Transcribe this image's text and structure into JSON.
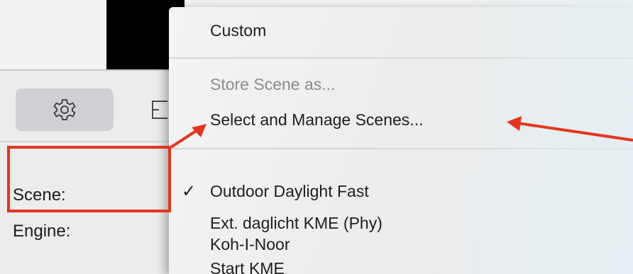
{
  "panel": {
    "scene_label": "Scene:",
    "engine_label": "Engine:"
  },
  "icons": {
    "settings": "gear-icon",
    "partial": "panel-icon"
  },
  "menu": {
    "items": [
      {
        "label": "Custom",
        "enabled": true
      },
      {
        "label": "Store Scene as...",
        "enabled": false
      },
      {
        "label": "Select and Manage Scenes...",
        "enabled": true
      },
      {
        "label": "Outdoor Daylight Fast",
        "enabled": true,
        "checked": true
      },
      {
        "label": "Ext. daglicht KME (Phy)",
        "enabled": true
      },
      {
        "label": "Koh-I-Noor",
        "enabled": true
      },
      {
        "label": "Start KME",
        "enabled": true
      }
    ],
    "check_mark": "✓"
  },
  "colors": {
    "annotation": "#e3351e",
    "gear_button_bg": "#cfcfd4"
  }
}
